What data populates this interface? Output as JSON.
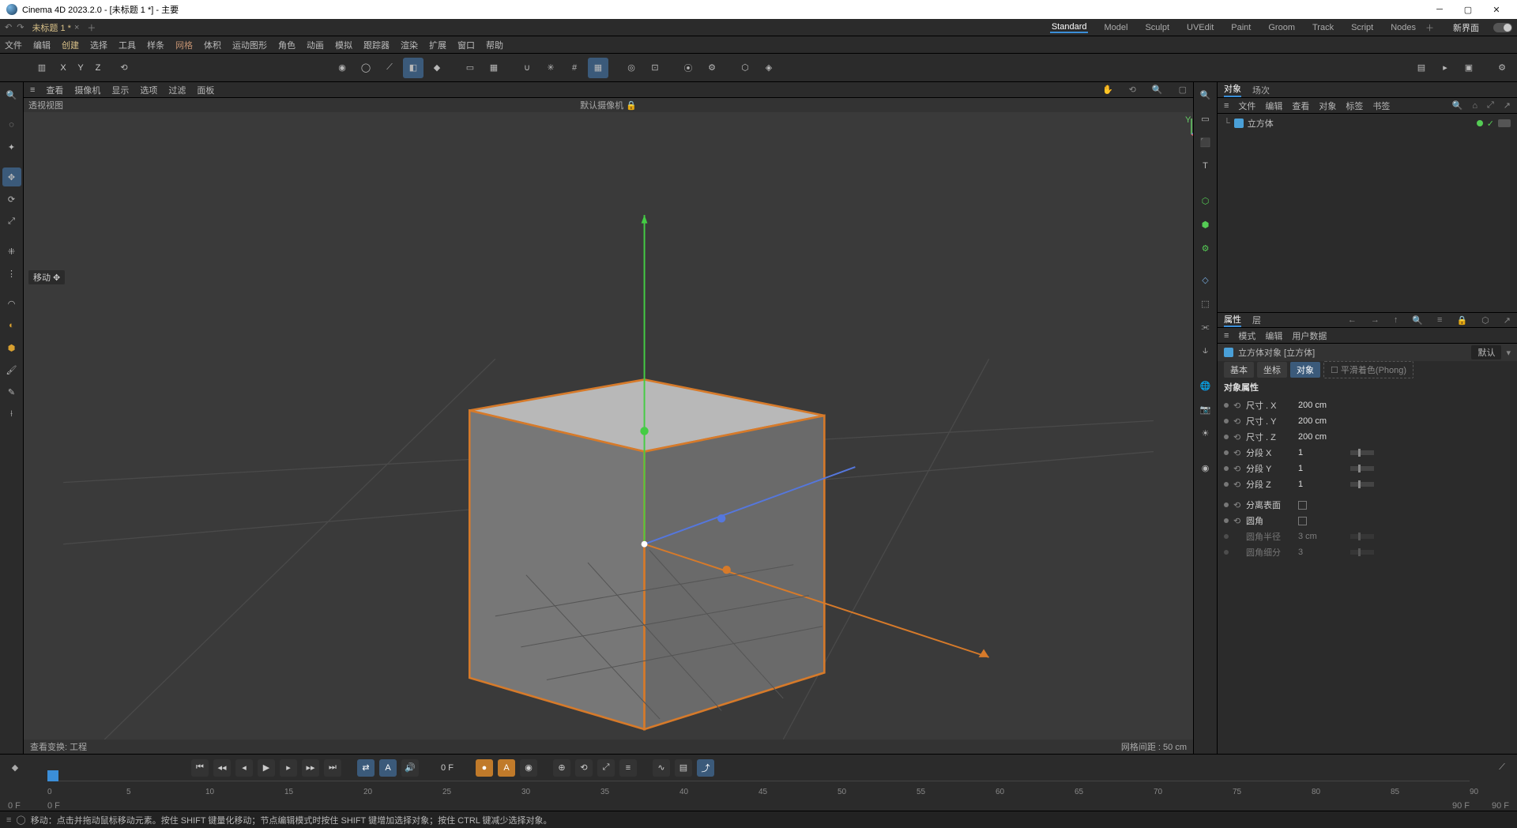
{
  "title": "Cinema 4D 2023.2.0 - [未标题 1 *] - 主要",
  "doc_tab": "未标题 1 *",
  "layouts": [
    "Standard",
    "Model",
    "Sculpt",
    "UVEdit",
    "Paint",
    "Groom",
    "Track",
    "Script",
    "Nodes"
  ],
  "active_layout": "Standard",
  "layout_label": "新界面",
  "top_menu": [
    "文件",
    "编辑",
    "创建",
    "选择",
    "工具",
    "样条",
    "网格",
    "体积",
    "运动图形",
    "角色",
    "动画",
    "模拟",
    "跟踪器",
    "渲染",
    "扩展",
    "窗口",
    "帮助"
  ],
  "top_menu_hl": {
    "创建": "hl1",
    "网格": "hl2"
  },
  "axis_letters": [
    "X",
    "Y",
    "Z"
  ],
  "viewport_menu": [
    "查看",
    "摄像机",
    "显示",
    "选项",
    "过滤",
    "面板"
  ],
  "viewport_label": "透视视图",
  "camera_label": "默认摄像机",
  "move_tool_label": "移动",
  "vp_footer_left": "查看变换: 工程",
  "vp_footer_right": "网格间距 : 50 cm",
  "objects_panel": {
    "tabs": [
      "对象",
      "场次"
    ],
    "menu": [
      "文件",
      "编辑",
      "查看",
      "对象",
      "标签",
      "书签"
    ],
    "item": "立方体"
  },
  "attributes_panel": {
    "tabs": [
      "属性",
      "层"
    ],
    "menu": [
      "模式",
      "编辑",
      "用户数据"
    ],
    "title": "立方体对象 [立方体]",
    "preset": "默认",
    "attr_tabs": [
      "基本",
      "坐标",
      "对象"
    ],
    "phong_tab": "平滑着色(Phong)",
    "section": "对象属性",
    "rows": [
      {
        "label": "尺寸 . X",
        "value": "200 cm",
        "slider": false,
        "rot": true
      },
      {
        "label": "尺寸 . Y",
        "value": "200 cm",
        "slider": false,
        "rot": true
      },
      {
        "label": "尺寸 . Z",
        "value": "200 cm",
        "slider": false,
        "rot": true
      },
      {
        "label": "分段 X",
        "value": "1",
        "slider": true,
        "rot": true
      },
      {
        "label": "分段 Y",
        "value": "1",
        "slider": true,
        "rot": true
      },
      {
        "label": "分段 Z",
        "value": "1",
        "slider": true,
        "rot": true
      }
    ],
    "checks": [
      {
        "label": "分离表面"
      },
      {
        "label": "圆角"
      }
    ],
    "disabled": [
      {
        "label": "圆角半径",
        "value": "3 cm"
      },
      {
        "label": "圆角细分",
        "value": "3"
      }
    ]
  },
  "timeline": {
    "current": "0 F",
    "start": "0 F",
    "start2": "0 F",
    "end": "90 F",
    "end2": "90 F",
    "ticks": [
      0,
      5,
      10,
      15,
      20,
      25,
      30,
      35,
      40,
      45,
      50,
      55,
      60,
      65,
      70,
      75,
      80,
      85,
      90
    ]
  },
  "status_text": "移动：点击并拖动鼠标移动元素。按住 SHIFT 键量化移动；节点编辑模式时按住 SHIFT 键增加选择对象；按住 CTRL 键减少选择对象。"
}
